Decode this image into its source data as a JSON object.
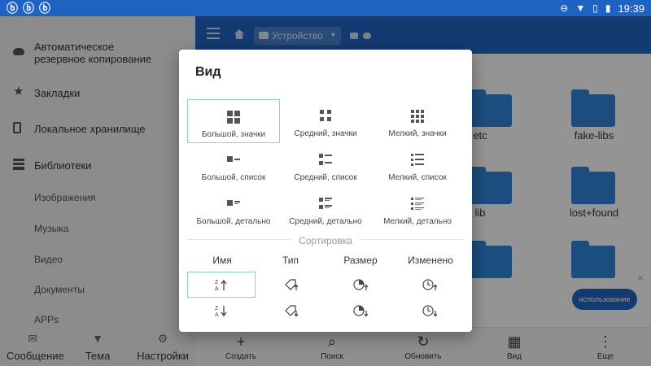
{
  "status": {
    "time": "19:39",
    "notif_icons": [
      "bug-icon",
      "bug-icon",
      "bug-icon"
    ]
  },
  "appbar": {
    "path": "Устройство"
  },
  "folders": [
    {
      "name": "etc"
    },
    {
      "name": "fake-libs"
    },
    {
      "name": "lib"
    },
    {
      "name": "lost+found"
    }
  ],
  "banner_button": "использование",
  "actionbar": [
    {
      "label": "Создать",
      "icon": "plus-icon"
    },
    {
      "label": "Поиск",
      "icon": "search-icon"
    },
    {
      "label": "Обновить",
      "icon": "refresh-icon"
    },
    {
      "label": "Вид",
      "icon": "view-icon"
    },
    {
      "label": "Еще",
      "icon": "more-icon"
    }
  ],
  "drawer": {
    "items": [
      {
        "label": "Автоматическое резервное копирование",
        "icon": "cloud-icon"
      },
      {
        "label": "Закладки",
        "icon": "star-icon"
      },
      {
        "label": "Локальное хранилище",
        "icon": "phone-icon"
      },
      {
        "label": "Библиотеки",
        "icon": "stack-icon"
      }
    ],
    "subitems": [
      "Изображения",
      "Музыка",
      "Видео",
      "Документы",
      "APPs"
    ],
    "bottom": [
      {
        "label": "Сообщение",
        "icon": "mail-icon"
      },
      {
        "label": "Тема",
        "icon": "shirt-icon"
      },
      {
        "label": "Настройки",
        "icon": "gear-icon"
      }
    ]
  },
  "dialog": {
    "title": "Вид",
    "view_options": [
      "Большой, значки",
      "Средний, значки",
      "Мелкий, значки",
      "Большой, список",
      "Средний, список",
      "Мелкий, список",
      "Большой, детально",
      "Средний, детально",
      "Мелкий, детально"
    ],
    "selected_view": "Большой, значки",
    "sort_title": "Сортировка",
    "sort_columns": [
      "Имя",
      "Тип",
      "Размер",
      "Изменено"
    ],
    "selected_sort": "Имя по возрастанию",
    "colors": {
      "accent": "#8ed6ae",
      "primary": "#2167c4"
    }
  }
}
